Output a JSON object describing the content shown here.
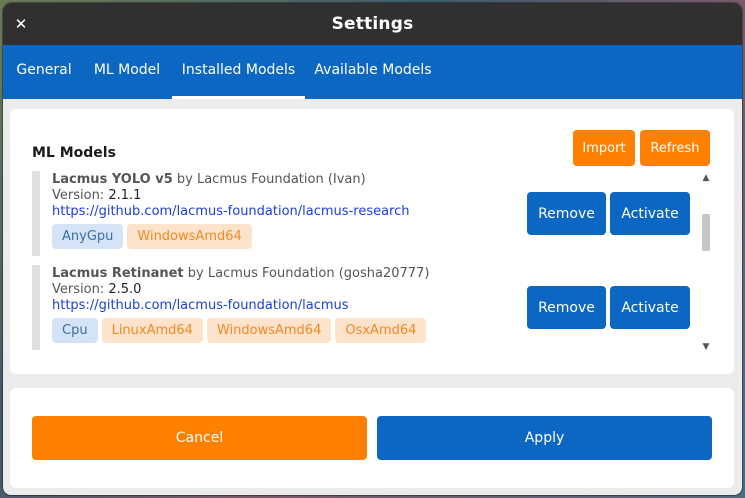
{
  "window": {
    "title": "Settings",
    "close_glyph": "✕"
  },
  "tabs": [
    {
      "label": "General",
      "active": false
    },
    {
      "label": "ML Model",
      "active": false
    },
    {
      "label": "Installed Models",
      "active": true
    },
    {
      "label": "Available Models",
      "active": false
    }
  ],
  "models_panel": {
    "title": "ML Models",
    "import_label": "Import",
    "refresh_label": "Refresh",
    "items": [
      {
        "name": "Lacmus YOLO v5",
        "by": "by Lacmus Foundation (Ivan)",
        "version_label": "Version:",
        "version": "2.1.1",
        "url": "https://github.com/lacmus-foundation/lacmus-research",
        "tags": [
          {
            "label": "AnyGpu",
            "kind": "gpu"
          },
          {
            "label": "WindowsAmd64",
            "kind": "os"
          }
        ],
        "remove_label": "Remove",
        "activate_label": "Activate"
      },
      {
        "name": "Lacmus Retinanet",
        "by": "by Lacmus Foundation (gosha20777)",
        "version_label": "Version:",
        "version": "2.5.0",
        "url": "https://github.com/lacmus-foundation/lacmus",
        "tags": [
          {
            "label": "Cpu",
            "kind": "gpu"
          },
          {
            "label": "LinuxAmd64",
            "kind": "os"
          },
          {
            "label": "WindowsAmd64",
            "kind": "os"
          },
          {
            "label": "OsxAmd64",
            "kind": "os"
          }
        ],
        "remove_label": "Remove",
        "activate_label": "Activate"
      }
    ]
  },
  "footer": {
    "cancel_label": "Cancel",
    "apply_label": "Apply"
  },
  "colors": {
    "accent_blue": "#0b67c2",
    "accent_orange": "#ff8000",
    "titlebar": "#303030"
  },
  "icons": {
    "close": "close-icon",
    "scroll_up": "arrow-up-icon",
    "scroll_down": "arrow-down-icon"
  }
}
